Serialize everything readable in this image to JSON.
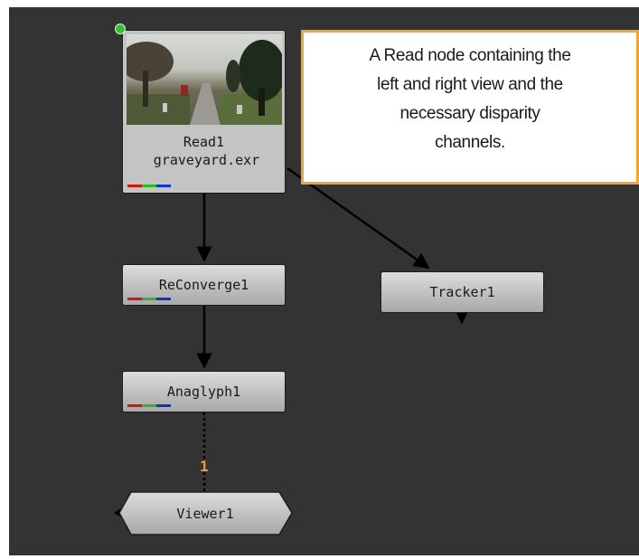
{
  "nodes": {
    "read": {
      "name": "Read1",
      "file": "graveyard.exr"
    },
    "reconverge": {
      "name": "ReConverge1"
    },
    "anaglyph": {
      "name": "Anaglyph1"
    },
    "tracker": {
      "name": "Tracker1"
    },
    "viewer": {
      "name": "Viewer1",
      "input_index": "1"
    }
  },
  "sticky_note": {
    "lines": [
      "A Read node containing the",
      "left and right view and the",
      "necessary disparity",
      "channels."
    ]
  },
  "colors": {
    "graph_background": "#333333",
    "node_fill": "#c0c0c0",
    "note_border": "#f0a830",
    "channel_red": "#e01010",
    "channel_green": "#20c020",
    "channel_blue": "#1030e0",
    "selected_dot": "#2fc42f"
  }
}
